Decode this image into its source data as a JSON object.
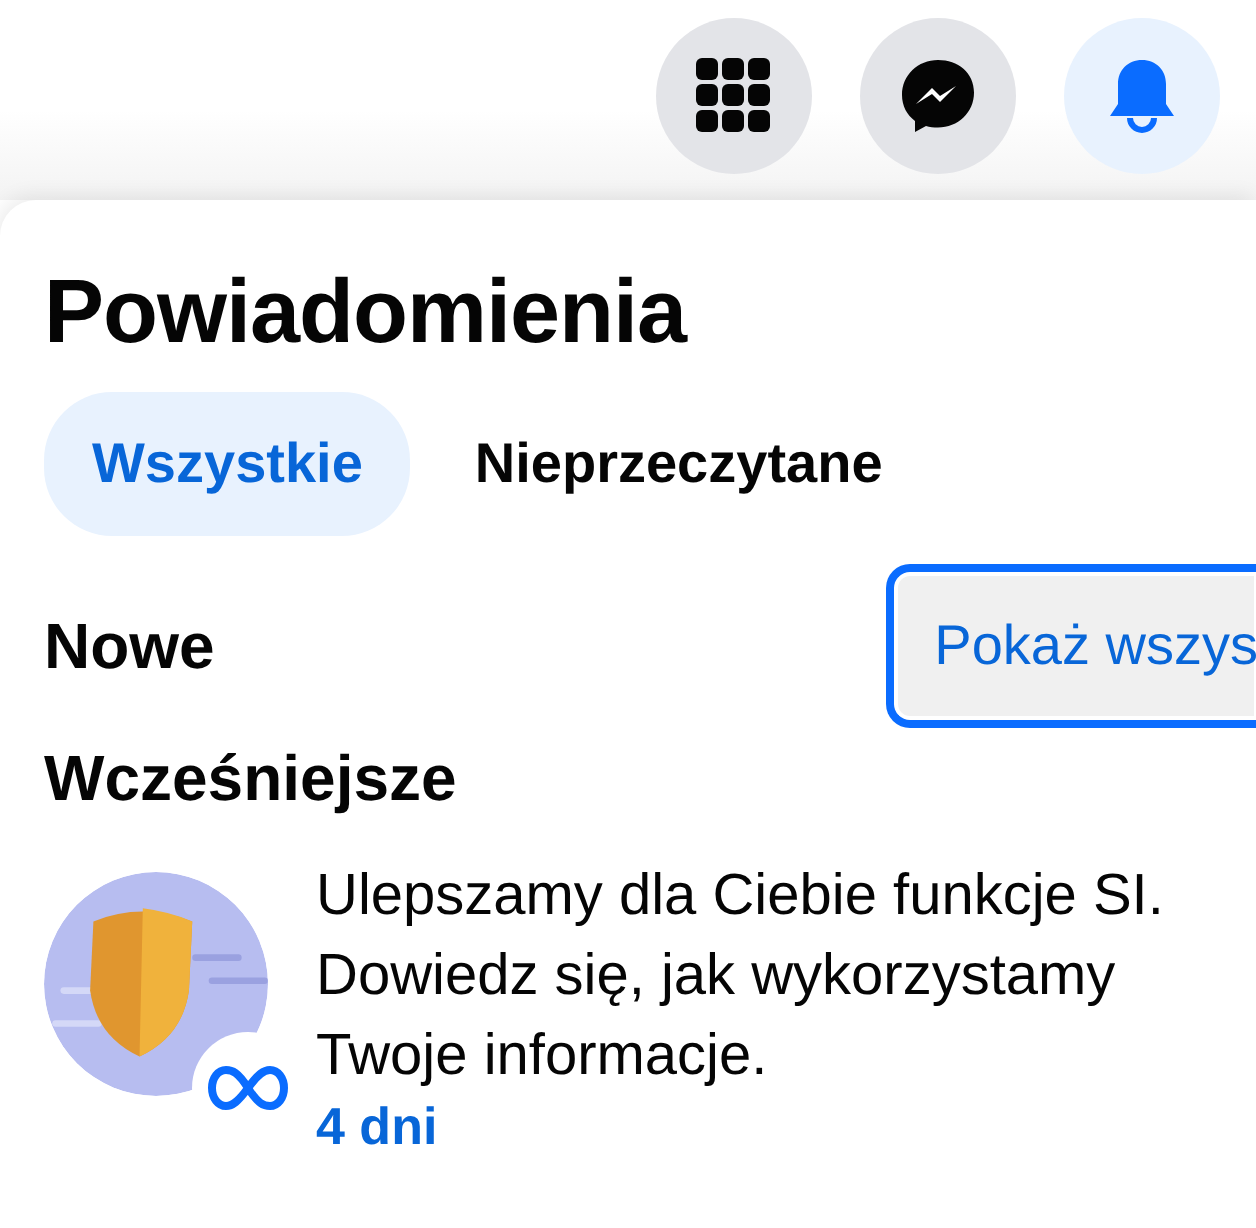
{
  "top_bar": {
    "buttons": [
      {
        "kind": "menu",
        "selected": false
      },
      {
        "kind": "messenger",
        "selected": false
      },
      {
        "kind": "bell",
        "selected": true
      }
    ]
  },
  "panel": {
    "title": "Powiadomienia",
    "tabs": [
      {
        "label": "Wszystkie",
        "selected": true
      },
      {
        "label": "Nieprzeczytane",
        "selected": false
      }
    ],
    "sections": [
      {
        "heading": "Nowe",
        "action": "Pokaż wszys"
      },
      {
        "heading": "Wcześniejsze"
      }
    ],
    "notifications": [
      {
        "text": "Ulepszamy dla Ciebie funkcje SI. Dowiedz się, jak wykorzystamy Twoje informacje.",
        "time": "4 dni"
      }
    ]
  }
}
